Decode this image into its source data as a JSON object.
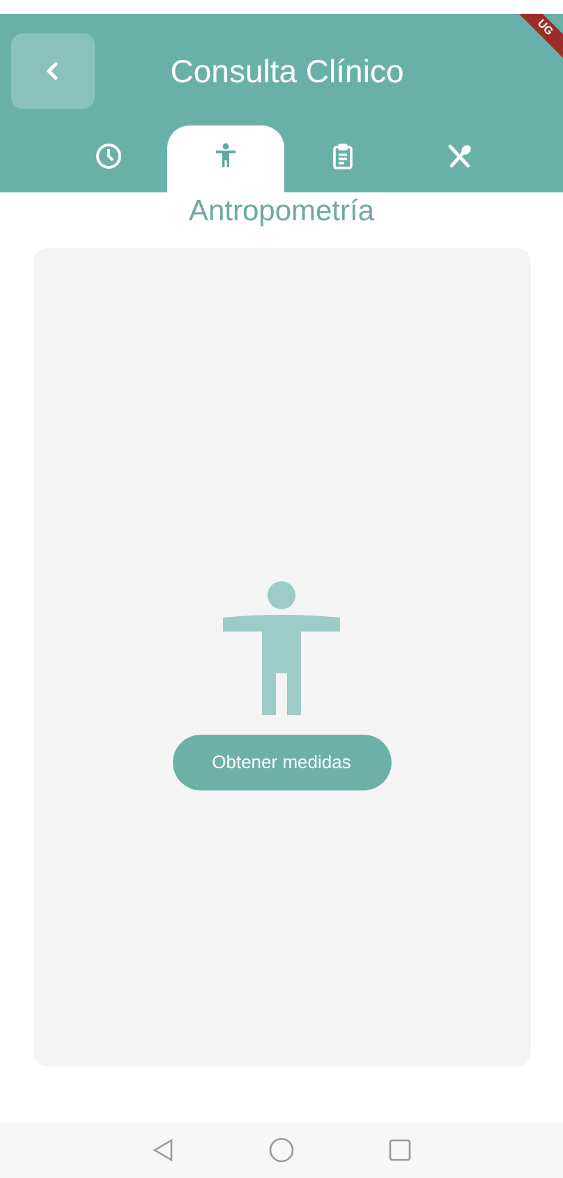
{
  "header": {
    "title": "Consulta Clínico",
    "debug_banner": "UG"
  },
  "tabs": [
    {
      "kind": "clock",
      "selected": false
    },
    {
      "kind": "figure",
      "selected": true
    },
    {
      "kind": "clipboard",
      "selected": false
    },
    {
      "kind": "utensils",
      "selected": false
    }
  ],
  "section": {
    "title": "Antropometría",
    "button": "Obtener medidas"
  }
}
